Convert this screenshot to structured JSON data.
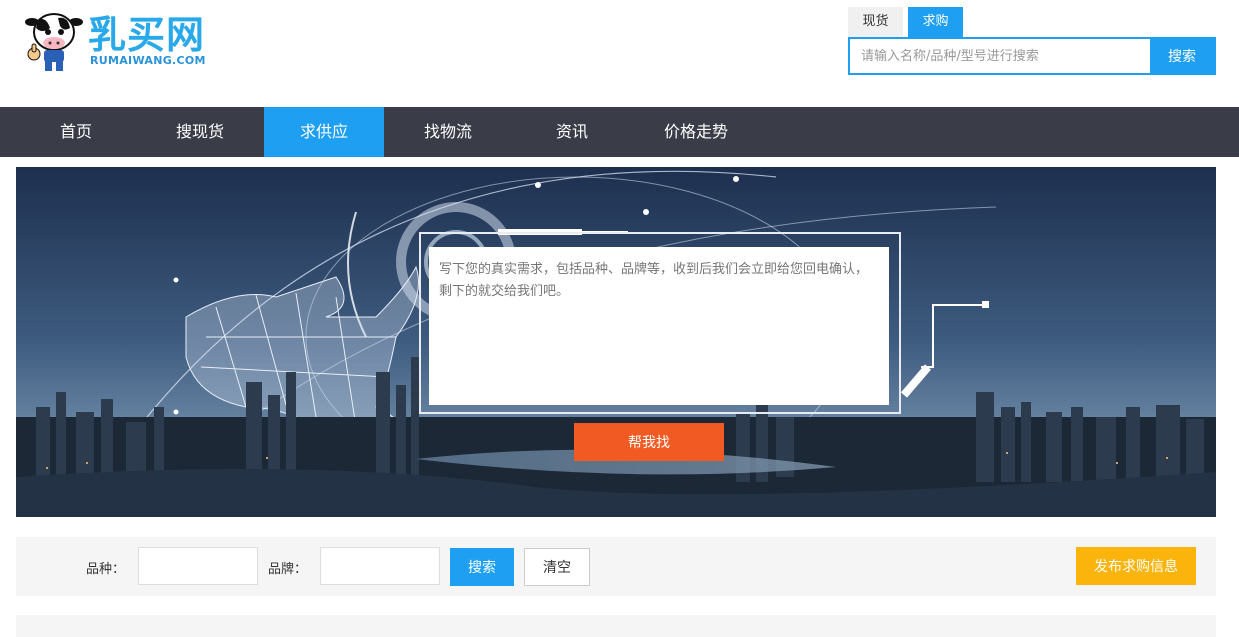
{
  "brand": {
    "logo_cn": "乳买网",
    "logo_en": "RUMAIWANG.COM"
  },
  "search": {
    "tabs": [
      {
        "label": "现货",
        "active": false
      },
      {
        "label": "求购",
        "active": true
      }
    ],
    "placeholder": "请输入名称/品种/型号进行搜索",
    "button_label": "搜索"
  },
  "nav": {
    "items": [
      {
        "label": "首页",
        "active": false
      },
      {
        "label": "搜现货",
        "active": false
      },
      {
        "label": "求供应",
        "active": true
      },
      {
        "label": "找物流",
        "active": false
      },
      {
        "label": "资讯",
        "active": false
      },
      {
        "label": "价格走势",
        "active": false
      }
    ]
  },
  "banner": {
    "request_placeholder": "写下您的真实需求，包括品种、品牌等，收到后我们会立即给您回电确认，剩下的就交给我们吧。",
    "help_button": "帮我找"
  },
  "filter": {
    "variety_label": "品种：",
    "brand_label": "品牌：",
    "search_button": "搜索",
    "clear_button": "清空",
    "publish_button": "发布求购信息"
  },
  "colors": {
    "accent": "#1e9ff2",
    "nav_bg": "#3a3c48",
    "help_button": "#f25a24",
    "publish_button": "#fbb40c"
  }
}
